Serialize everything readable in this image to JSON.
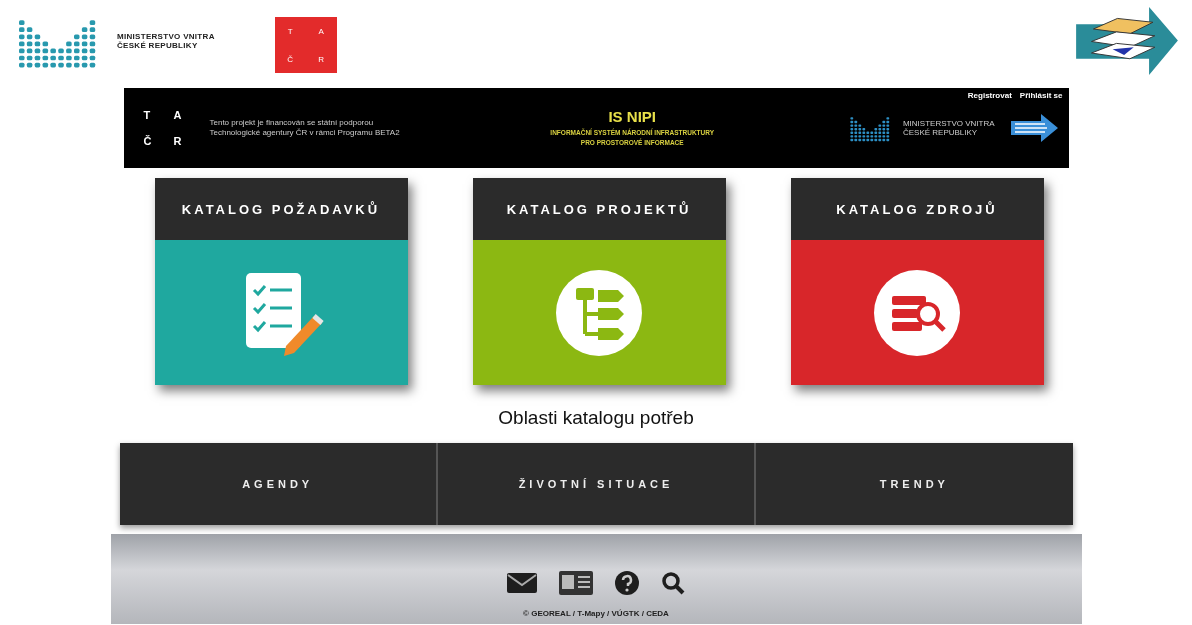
{
  "header": {
    "ministry_logo": {
      "line1": "MINISTERSTVO VNITRA",
      "line2": "ČESKÉ REPUBLIKY"
    },
    "tacr_logo": {
      "letters": [
        "T",
        "A",
        "Č",
        "R"
      ]
    }
  },
  "banner": {
    "tacr_letters": [
      "T",
      "A",
      "Č",
      "R"
    ],
    "funding_note": "Tento projekt je financován se státní podporou Technologické agentury ČR v rámci Programu BETA2",
    "title": "IS NIPI",
    "subtitle_lines": [
      "INFORMAČNÍ SYSTÉM NÁRODNÍ INFRASTRUKTURY",
      "PRO PROSTOROVÉ INFORMACE"
    ],
    "ministry_logo": {
      "line1": "MINISTERSTVO VNITRA",
      "line2": "ČESKÉ REPUBLIKY"
    },
    "links": [
      "Registrovat",
      "Přihlásit se"
    ]
  },
  "catalogs": [
    {
      "title": "KATALOG POŽADAVKŮ",
      "kind": "checklist",
      "color": "#1fa89f"
    },
    {
      "title": "KATALOG PROJEKTŮ",
      "kind": "hierarchy",
      "color": "#8cb812"
    },
    {
      "title": "KATALOG ZDROJŮ",
      "kind": "database",
      "color": "#d8262a"
    }
  ],
  "section_title": "Oblasti katalogu potřeb",
  "areas": [
    "AGENDY",
    "ŽIVOTNÍ SITUACE",
    "TRENDY"
  ],
  "footer": {
    "copyright": "© GEOREAL / T-Mapy / VÚGTK / CEDA"
  }
}
